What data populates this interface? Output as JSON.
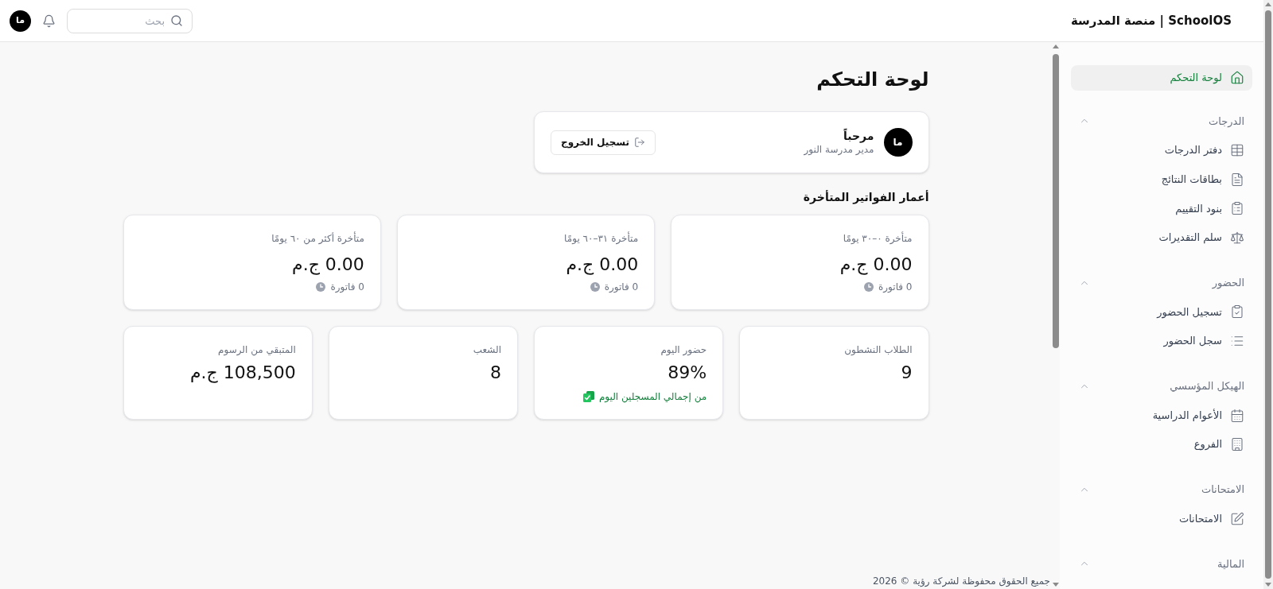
{
  "header": {
    "title": "SchoolOS | منصة المدرسة",
    "search": {
      "placeholder": "بحث"
    },
    "avatar": "ما"
  },
  "sidebar": {
    "items": [
      {
        "label": "لوحة التحكم",
        "selected": true
      }
    ],
    "sections": [
      {
        "title": "الدرجات",
        "expanded": true,
        "items": [
          {
            "label": "دفتر الدرجات",
            "selected": false
          },
          {
            "label": "بطاقات النتائج",
            "selected": false
          },
          {
            "label": "بنود التقييم",
            "selected": false
          },
          {
            "label": "سلم التقديرات",
            "selected": false
          }
        ]
      },
      {
        "title": "الحضور",
        "expanded": true,
        "items": [
          {
            "label": "تسجيل الحضور",
            "selected": false
          },
          {
            "label": "سجل الحضور",
            "selected": false
          }
        ]
      },
      {
        "title": "الهيكل المؤسسي",
        "expanded": true,
        "items": [
          {
            "label": "الأعوام الدراسية",
            "selected": false
          },
          {
            "label": "الفروع",
            "selected": false
          }
        ]
      },
      {
        "title": "الامتحانات",
        "expanded": true,
        "items": [
          {
            "label": "الامتحانات",
            "selected": false
          }
        ]
      },
      {
        "title": "المالية",
        "expanded": true
      }
    ]
  },
  "main": {
    "title": "لوحة التحكم",
    "welcome": {
      "avatar": "ما",
      "greeting": "مرحباً",
      "role": "مدير مدرسة النور",
      "logout": "تسجيل الخروج"
    },
    "aging": {
      "title": "أعمار الفواتير المتأخرة",
      "cards": [
        {
          "label": "متأخرة ٠–٣٠ يومًا",
          "amount": "0.00 ج.م",
          "count": "0 فاتورة"
        },
        {
          "label": "متأخرة ٣١–٦٠ يومًا",
          "amount": "0.00 ج.م",
          "count": "0 فاتورة"
        },
        {
          "label": "متأخرة أكثر من ٦٠ يومًا",
          "amount": "0.00 ج.م",
          "count": "0 فاتورة"
        }
      ]
    },
    "stats": [
      {
        "label": "الطلاب النشطون",
        "value": "9"
      },
      {
        "label": "حضور اليوم",
        "value": "89%",
        "note": "من إجمالي المسجلين اليوم"
      },
      {
        "label": "الشعب",
        "value": "8"
      },
      {
        "label": "المتبقي من الرسوم",
        "value": "108,500 ج.م"
      }
    ]
  },
  "footer": "جميع الحقوق محفوظة لشركة رؤية © 2026"
}
